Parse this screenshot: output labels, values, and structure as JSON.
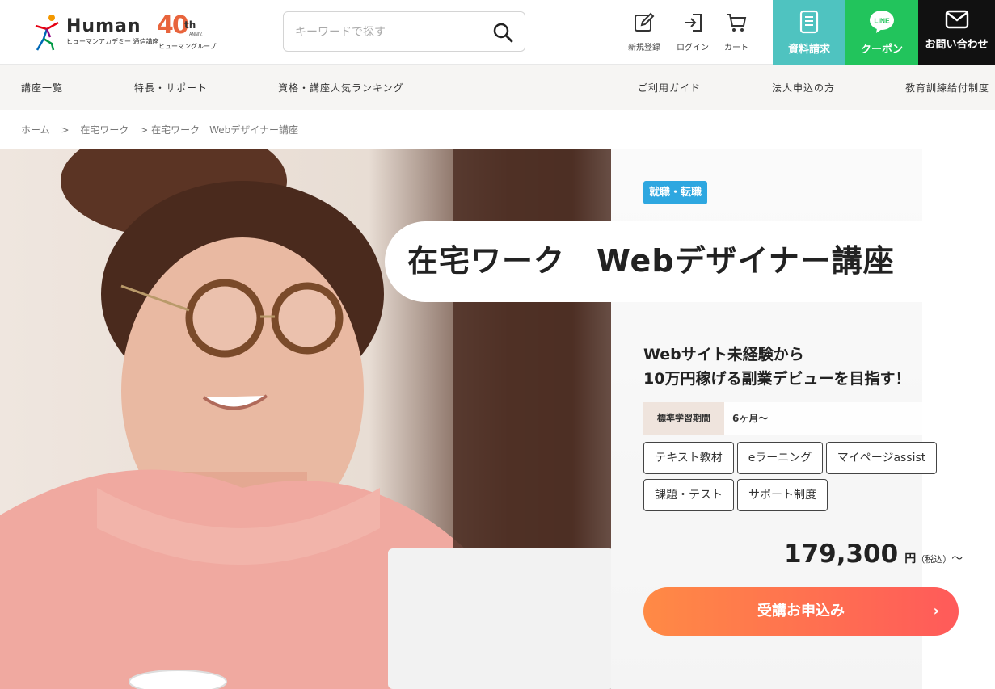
{
  "header": {
    "brand": {
      "wordmark": "Human",
      "subtitle": "ヒューマンアカデミー 通信講座"
    },
    "anniversary": {
      "number": "40",
      "suffix": "th",
      "tag": "ANNIV.",
      "subtitle": "ヒューマングループ"
    },
    "search": {
      "placeholder": "キーワードで探す",
      "icon": "search-icon"
    },
    "utility": [
      {
        "label": "新規登録",
        "icon": "pencil-square-icon"
      },
      {
        "label": "ログイン",
        "icon": "login-icon"
      },
      {
        "label": "カート",
        "icon": "cart-icon"
      }
    ],
    "cta": [
      {
        "label": "資料請求",
        "icon": "document-list-icon",
        "color": "#4fc3c0"
      },
      {
        "label": "クーポン",
        "icon": "line-icon",
        "icon_text": "LINE",
        "color": "#22c45c"
      },
      {
        "label": "お問い合わせ",
        "icon": "mail-icon",
        "color": "#111111"
      }
    ]
  },
  "nav": {
    "items": [
      "講座一覧",
      "特長・サポート",
      "資格・講座人気ランキング",
      "ご利用ガイド",
      "法人申込の方",
      "教育訓練給付制度"
    ]
  },
  "breadcrumb": {
    "items": [
      "ホーム",
      ">",
      "在宅ワーク",
      "> 在宅ワーク　Webデザイナー講座"
    ]
  },
  "hero": {
    "tag": "就職・転職",
    "title": "在宅ワーク　Webデザイナー講座",
    "catch_line1": "Webサイト未経験から",
    "catch_line2": "10万円稼げる副業デビューを目指す！",
    "period_label": "標準学習期間",
    "period_value": "6ヶ月〜",
    "features": [
      "テキスト教材",
      "eラーニング",
      "マイページassist",
      "課題・テスト",
      "サポート制度"
    ],
    "price": "179,300",
    "price_unit": "円",
    "price_tax": "（税込）",
    "price_from": "〜",
    "apply_label": "受講お申込み",
    "apply_arrow": "›",
    "accent_color": "#ff7a4f",
    "tag_color": "#2ea7e0"
  }
}
